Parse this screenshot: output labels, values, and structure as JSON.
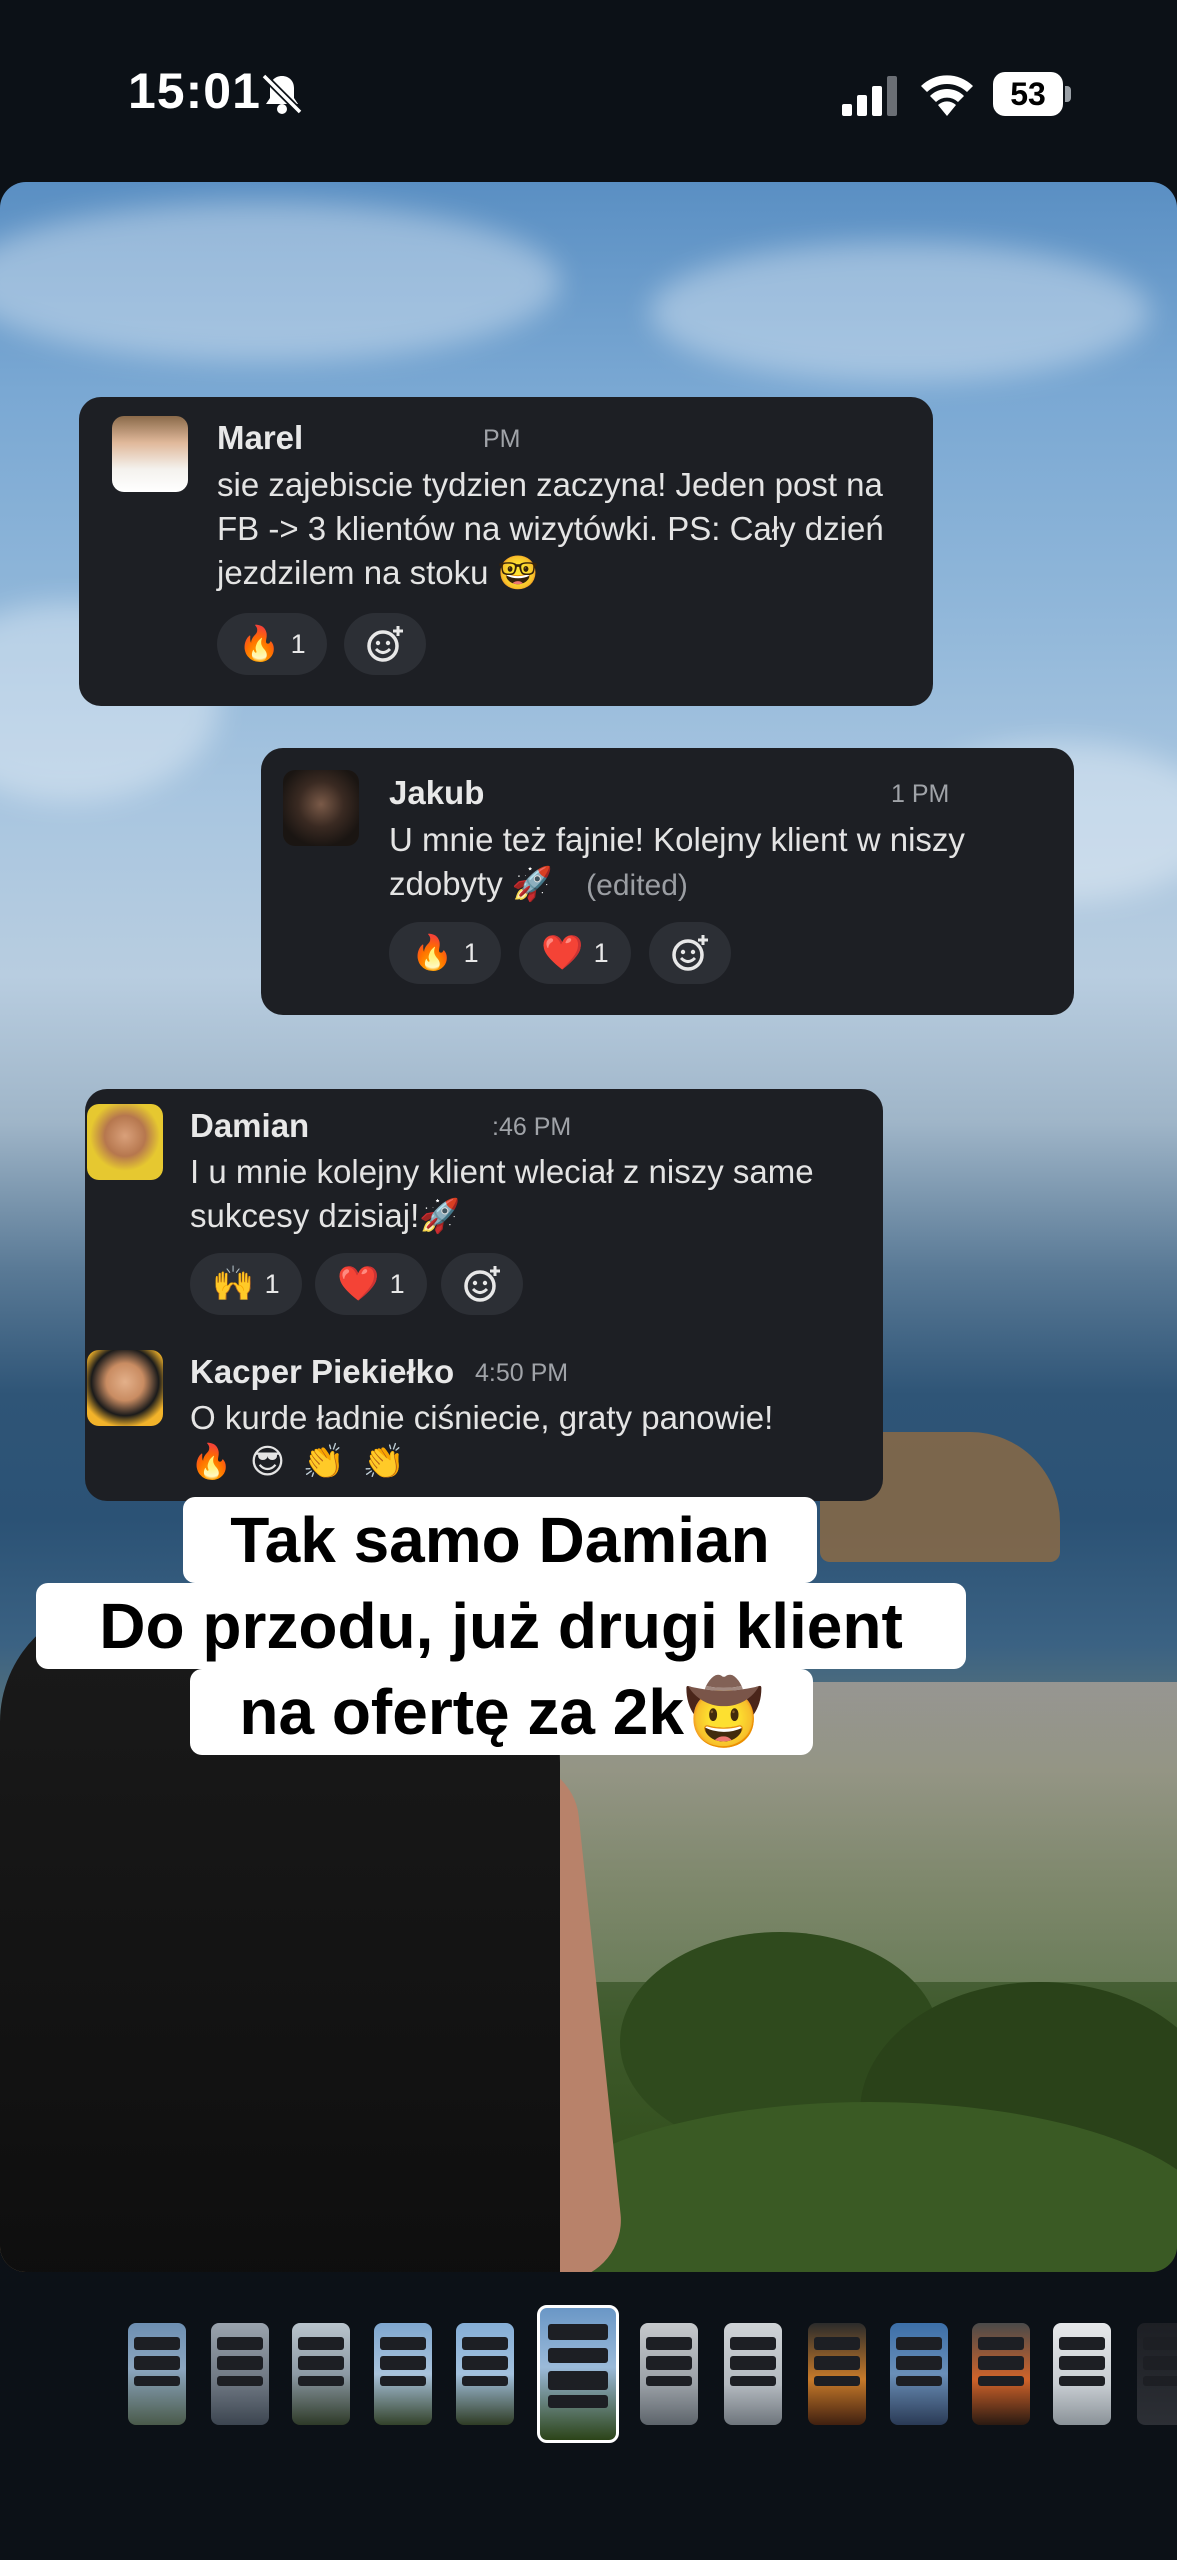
{
  "status_bar": {
    "time": "15:01",
    "battery": "53",
    "icons": [
      "bell-slash-icon",
      "cellular-signal-icon",
      "wifi-icon",
      "battery-icon"
    ]
  },
  "messages": [
    {
      "author": "Marel",
      "timestamp": "PM",
      "text": "sie zajebiscie tydzien zaczyna! Jeden post na FB -> 3 klientów na wizytówki. PS: Cały dzień jezdzilem na stoku 🤓",
      "reactions": [
        {
          "emoji": "🔥",
          "count": "1"
        }
      ]
    },
    {
      "author": "Jakub",
      "timestamp": "1 PM",
      "text": "U mnie też fajnie! Kolejny klient w niszy zdobyty 🚀",
      "edited_label": "(edited)",
      "reactions": [
        {
          "emoji": "🔥",
          "count": "1"
        },
        {
          "emoji": "❤️",
          "count": "1"
        }
      ]
    },
    {
      "author": "Damian",
      "timestamp": ":46 PM",
      "text": "I u mnie kolejny klient wleciał z niszy same sukcesy dzisiaj!🚀",
      "reactions": [
        {
          "emoji": "🙌",
          "count": "1"
        },
        {
          "emoji": "❤️",
          "count": "1"
        }
      ]
    },
    {
      "author": "Kacper Piekiełko",
      "timestamp": "4:50 PM",
      "text": "O kurde ładnie ciśniecie, graty panowie!",
      "emoji_line": "🔥 😎 👏 👏"
    }
  ],
  "caption": {
    "line1": "Tak samo Damian",
    "line2": "Do przodu, już drugi klient",
    "line3": "na ofertę za 2k🤠"
  },
  "thumbnails": {
    "count": 13,
    "active_index": 5
  },
  "colors": {
    "background": "#0c1117",
    "card": "#1d1f24",
    "pill": "#2c2f35",
    "caption_bg": "#ffffff"
  }
}
